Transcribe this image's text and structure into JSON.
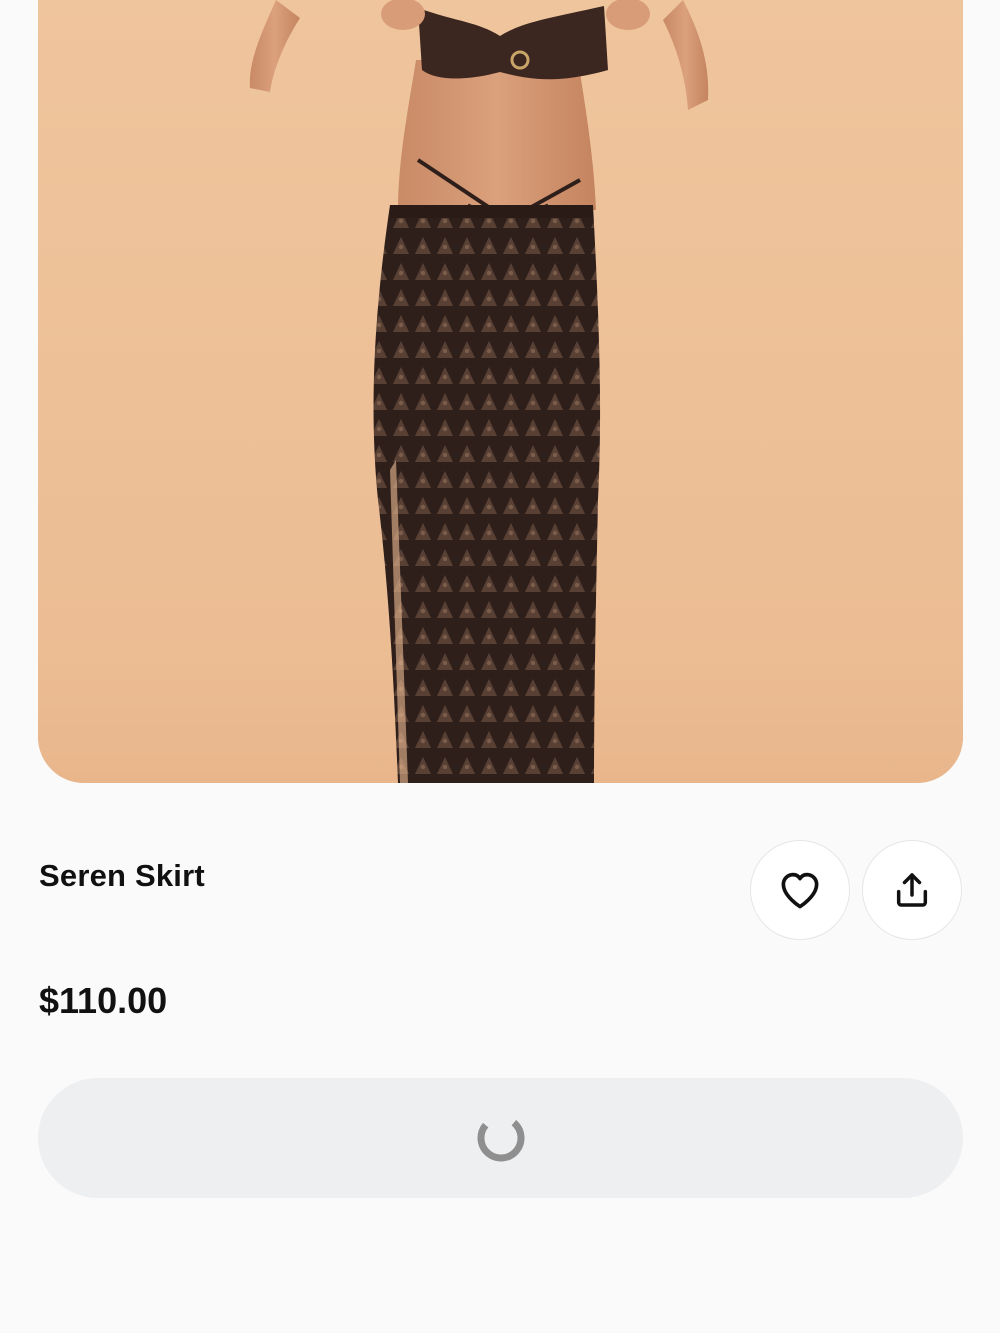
{
  "product": {
    "title": "Seren Skirt",
    "price": "$110.00",
    "image_alt": "Model wearing brown crochet maxi skirt with brown bandeau top"
  },
  "actions": {
    "favorite_icon": "heart-icon",
    "share_icon": "share-icon",
    "add_to_cart_state": "loading",
    "loading_icon": "spinner-icon"
  },
  "colors": {
    "page_background": "#fafafa",
    "image_background": "#eec39b",
    "garment": "#3a2620",
    "button_background": "#eeeff0",
    "spinner": "#8f8f8f"
  }
}
